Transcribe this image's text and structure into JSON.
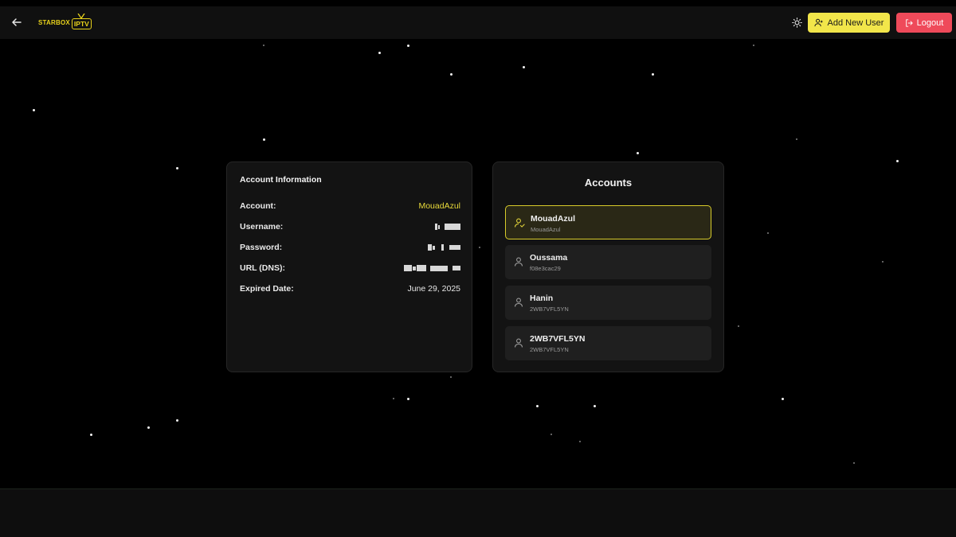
{
  "header": {
    "logo_word": "STARBOX",
    "logo_badge": "IPTV",
    "add_user_label": "Add New User",
    "logout_label": "Logout"
  },
  "account_info": {
    "title": "Account Information",
    "rows": [
      {
        "label": "Account:",
        "value": "MouadAzul"
      },
      {
        "label": "Username:",
        "value": ""
      },
      {
        "label": "Password:",
        "value": ""
      },
      {
        "label": "URL (DNS):",
        "value": ""
      },
      {
        "label": "Expired Date:",
        "value": "June 29, 2025"
      }
    ]
  },
  "accounts": {
    "title": "Accounts",
    "items": [
      {
        "name": "MouadAzul",
        "sub": "MouadAzul",
        "active": true
      },
      {
        "name": "Oussama",
        "sub": "f08e3cac29",
        "active": false
      },
      {
        "name": "Hanin",
        "sub": "2WB7VFL5YN",
        "active": false
      },
      {
        "name": "2WB7VFL5YN",
        "sub": "2WB7VFL5YN",
        "active": false
      }
    ]
  },
  "colors": {
    "accent_yellow": "#f2e64a",
    "logout_red": "#ef4a5a",
    "background": "#000000",
    "card": "#131313"
  }
}
